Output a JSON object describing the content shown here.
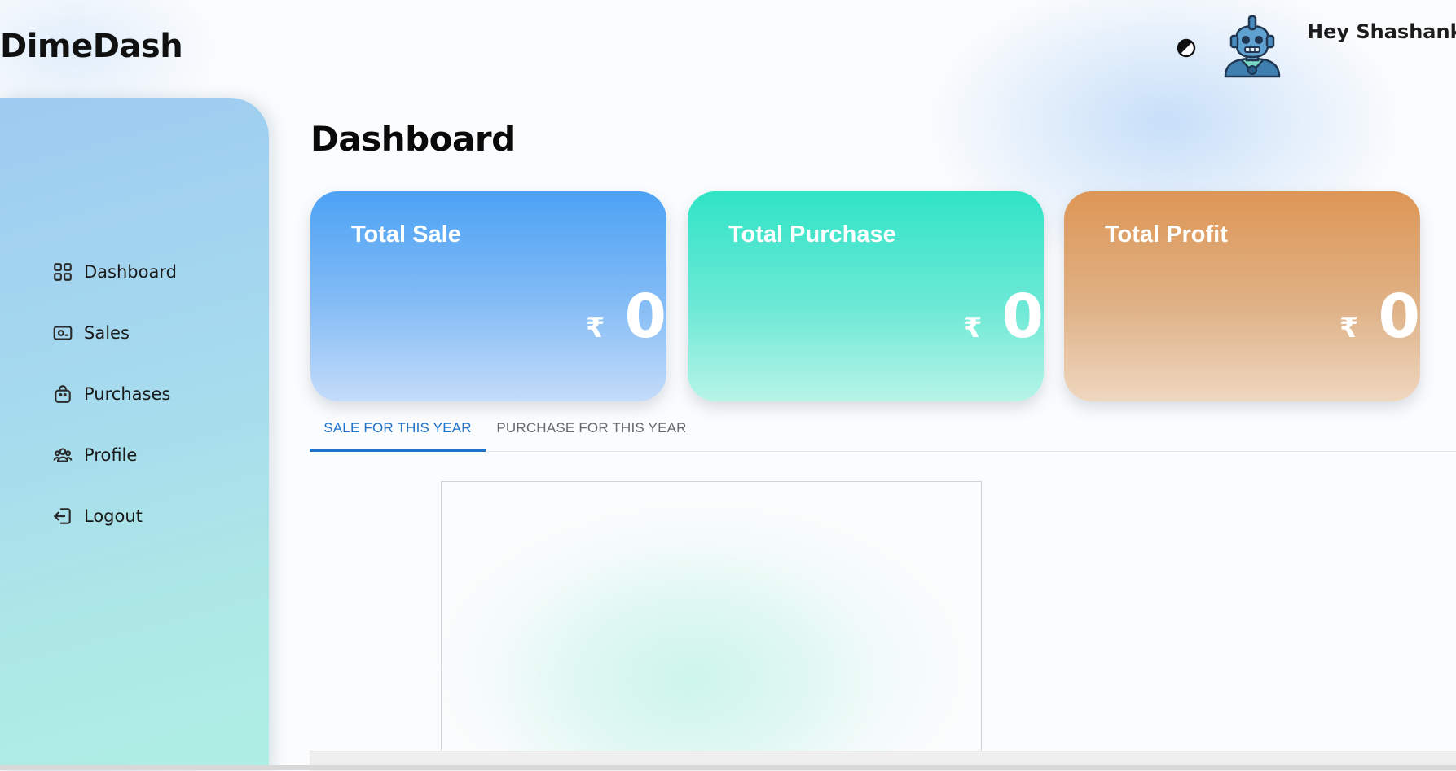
{
  "app": {
    "name": "DimeDash"
  },
  "header": {
    "greeting": "Hey Shashank Shekhar",
    "theme_toggle_icon": "contrast-icon",
    "avatar_icon": "robot-avatar-icon"
  },
  "sidebar": {
    "items": [
      {
        "label": "Dashboard",
        "icon": "grid-icon"
      },
      {
        "label": "Sales",
        "icon": "cash-icon"
      },
      {
        "label": "Purchases",
        "icon": "shopping-bag-icon"
      },
      {
        "label": "Profile",
        "icon": "users-icon"
      },
      {
        "label": "Logout",
        "icon": "logout-icon"
      }
    ]
  },
  "main": {
    "title": "Dashboard",
    "cards": [
      {
        "title": "Total Sale",
        "currency": "₹",
        "value": "0",
        "color": "#4ca2f5"
      },
      {
        "title": "Total Purchase",
        "currency": "₹",
        "value": "0",
        "color": "#2fe4c6"
      },
      {
        "title": "Total Profit",
        "currency": "₹",
        "value": "0",
        "color": "#de9655"
      }
    ],
    "tabs": [
      {
        "label": "SALE FOR THIS YEAR",
        "active": true
      },
      {
        "label": "PURCHASE FOR THIS YEAR",
        "active": false
      }
    ]
  },
  "colors": {
    "accent": "#1f73c8",
    "sidebar_top": "#9ecbf1",
    "sidebar_bottom": "#aeefe4"
  }
}
